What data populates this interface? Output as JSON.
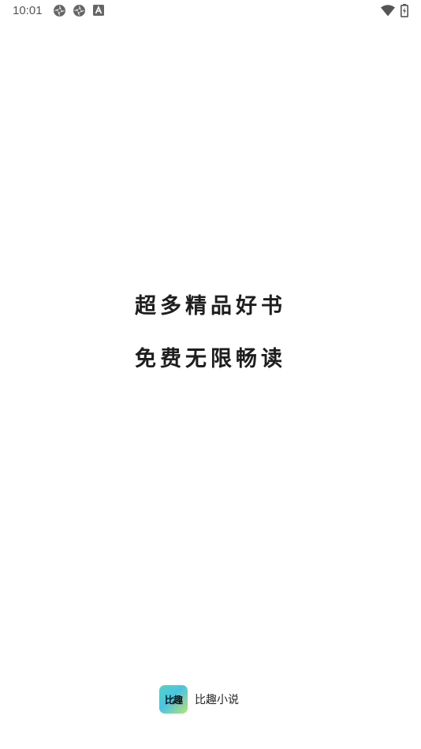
{
  "status_bar": {
    "time": "10:01",
    "left_icons": [
      "settings-aperture-icon",
      "settings-aperture-icon",
      "font-a-icon"
    ],
    "right_icons": [
      "wifi-icon",
      "battery-icon"
    ]
  },
  "splash": {
    "slogan_line_1": "超多精品好书",
    "slogan_line_2": "免费无限畅读"
  },
  "brand": {
    "logo_text": "比趣",
    "app_name": "比趣小说",
    "logo_colors": [
      "#4fd4c6",
      "#4cc3e3",
      "#b6e46e"
    ]
  }
}
